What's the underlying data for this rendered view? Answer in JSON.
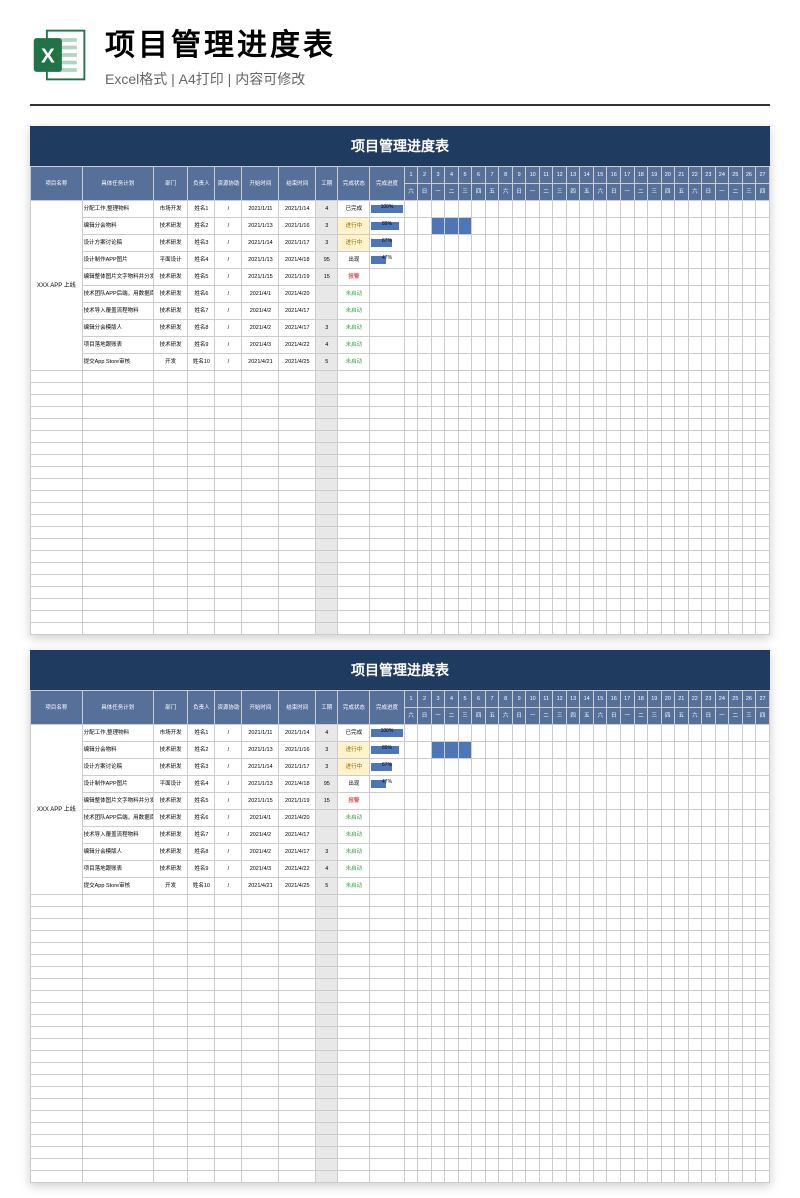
{
  "header": {
    "title": "项目管理进度表",
    "subtitle": "Excel格式 | A4打印 | 内容可修改"
  },
  "sheet": {
    "title": "项目管理进度表",
    "columns": {
      "project": "项目名称",
      "task": "具体任务计划",
      "dept": "部门",
      "owner": "负责人",
      "resource": "资源协助",
      "start": "开始时间",
      "end": "结束时间",
      "duration": "工期",
      "status": "完成状态",
      "progress": "完成进度"
    },
    "project_name": "XXX APP 上线",
    "days_top": [
      "1",
      "2",
      "3",
      "4",
      "5",
      "6",
      "7",
      "8",
      "9",
      "10",
      "11",
      "12",
      "13",
      "14",
      "15",
      "16",
      "17",
      "18",
      "19",
      "20",
      "21",
      "22",
      "23",
      "24",
      "25",
      "26",
      "27"
    ],
    "days_wk": [
      "六",
      "日",
      "一",
      "二",
      "三",
      "四",
      "五",
      "六",
      "日",
      "一",
      "二",
      "三",
      "四",
      "五",
      "六",
      "日",
      "一",
      "二",
      "三",
      "四",
      "五",
      "六",
      "日",
      "一",
      "二",
      "三",
      "四"
    ],
    "rows": [
      {
        "task": "分配工作,整理物料",
        "dept": "市场开发",
        "owner": "姓名1",
        "res": "/",
        "start": "2021/1/11",
        "end": "2021/1/14",
        "dur": "4",
        "status": "已完成",
        "status_cls": "status-done",
        "prog": 100,
        "gstart": 0,
        "glen": 0
      },
      {
        "task": "编辑分会物料",
        "dept": "技术研发",
        "owner": "姓名2",
        "res": "/",
        "start": "2021/1/13",
        "end": "2021/1/16",
        "dur": "3",
        "status": "进行中",
        "status_cls": "status-doing",
        "prog": 89,
        "gstart": 2,
        "glen": 3
      },
      {
        "task": "设计方案讨论稿",
        "dept": "技术研发",
        "owner": "姓名3",
        "res": "/",
        "start": "2021/1/14",
        "end": "2021/1/17",
        "dur": "3",
        "status": "进行中",
        "status_cls": "status-doing",
        "prog": 67,
        "gstart": 0,
        "glen": 0
      },
      {
        "task": "设计制作APP图片",
        "dept": "平面设计",
        "owner": "姓名4",
        "res": "/",
        "start": "2021/1/13",
        "end": "2021/4/18",
        "dur": "95",
        "status": "出现",
        "status_cls": "",
        "prog": 47,
        "gstart": 0,
        "glen": 0
      },
      {
        "task": "编辑整体图片文字物料并分发",
        "dept": "技术研发",
        "owner": "姓名5",
        "res": "/",
        "start": "2021/1/15",
        "end": "2021/1/19",
        "dur": "15",
        "status": "报警",
        "status_cls": "status-warn",
        "prog": 0,
        "gstart": 0,
        "glen": 0
      },
      {
        "task": "技术团队APP后端，用数据库",
        "dept": "技术研发",
        "owner": "姓名6",
        "res": "/",
        "start": "2021/4/1",
        "end": "2021/4/20",
        "dur": "",
        "status": "未启动",
        "status_cls": "status-not",
        "prog": 0,
        "gstart": 0,
        "glen": 0
      },
      {
        "task": "技术导入覆盖流程物料",
        "dept": "技术研发",
        "owner": "姓名7",
        "res": "/",
        "start": "2021/4/2",
        "end": "2021/4/17",
        "dur": "",
        "status": "未启动",
        "status_cls": "status-not",
        "prog": 0,
        "gstart": 0,
        "glen": 0
      },
      {
        "task": "编辑分会模版人",
        "dept": "技术研发",
        "owner": "姓名8",
        "res": "/",
        "start": "2021/4/2",
        "end": "2021/4/17",
        "dur": "3",
        "status": "未启动",
        "status_cls": "status-not",
        "prog": 0,
        "gstart": 0,
        "glen": 0
      },
      {
        "task": "项目落地跟账表",
        "dept": "技术研发",
        "owner": "姓名9",
        "res": "/",
        "start": "2021/4/3",
        "end": "2021/4/22",
        "dur": "4",
        "status": "未启动",
        "status_cls": "status-not",
        "prog": 0,
        "gstart": 0,
        "glen": 0
      },
      {
        "task": "提交App Store审核",
        "dept": "开发",
        "owner": "姓名10",
        "res": "/",
        "start": "2021/4/21",
        "end": "2021/4/25",
        "dur": "5",
        "status": "未启动",
        "status_cls": "status-not",
        "prog": 0,
        "gstart": 0,
        "glen": 0
      }
    ],
    "empty_rows": 22,
    "empty_rows_2": 24
  }
}
